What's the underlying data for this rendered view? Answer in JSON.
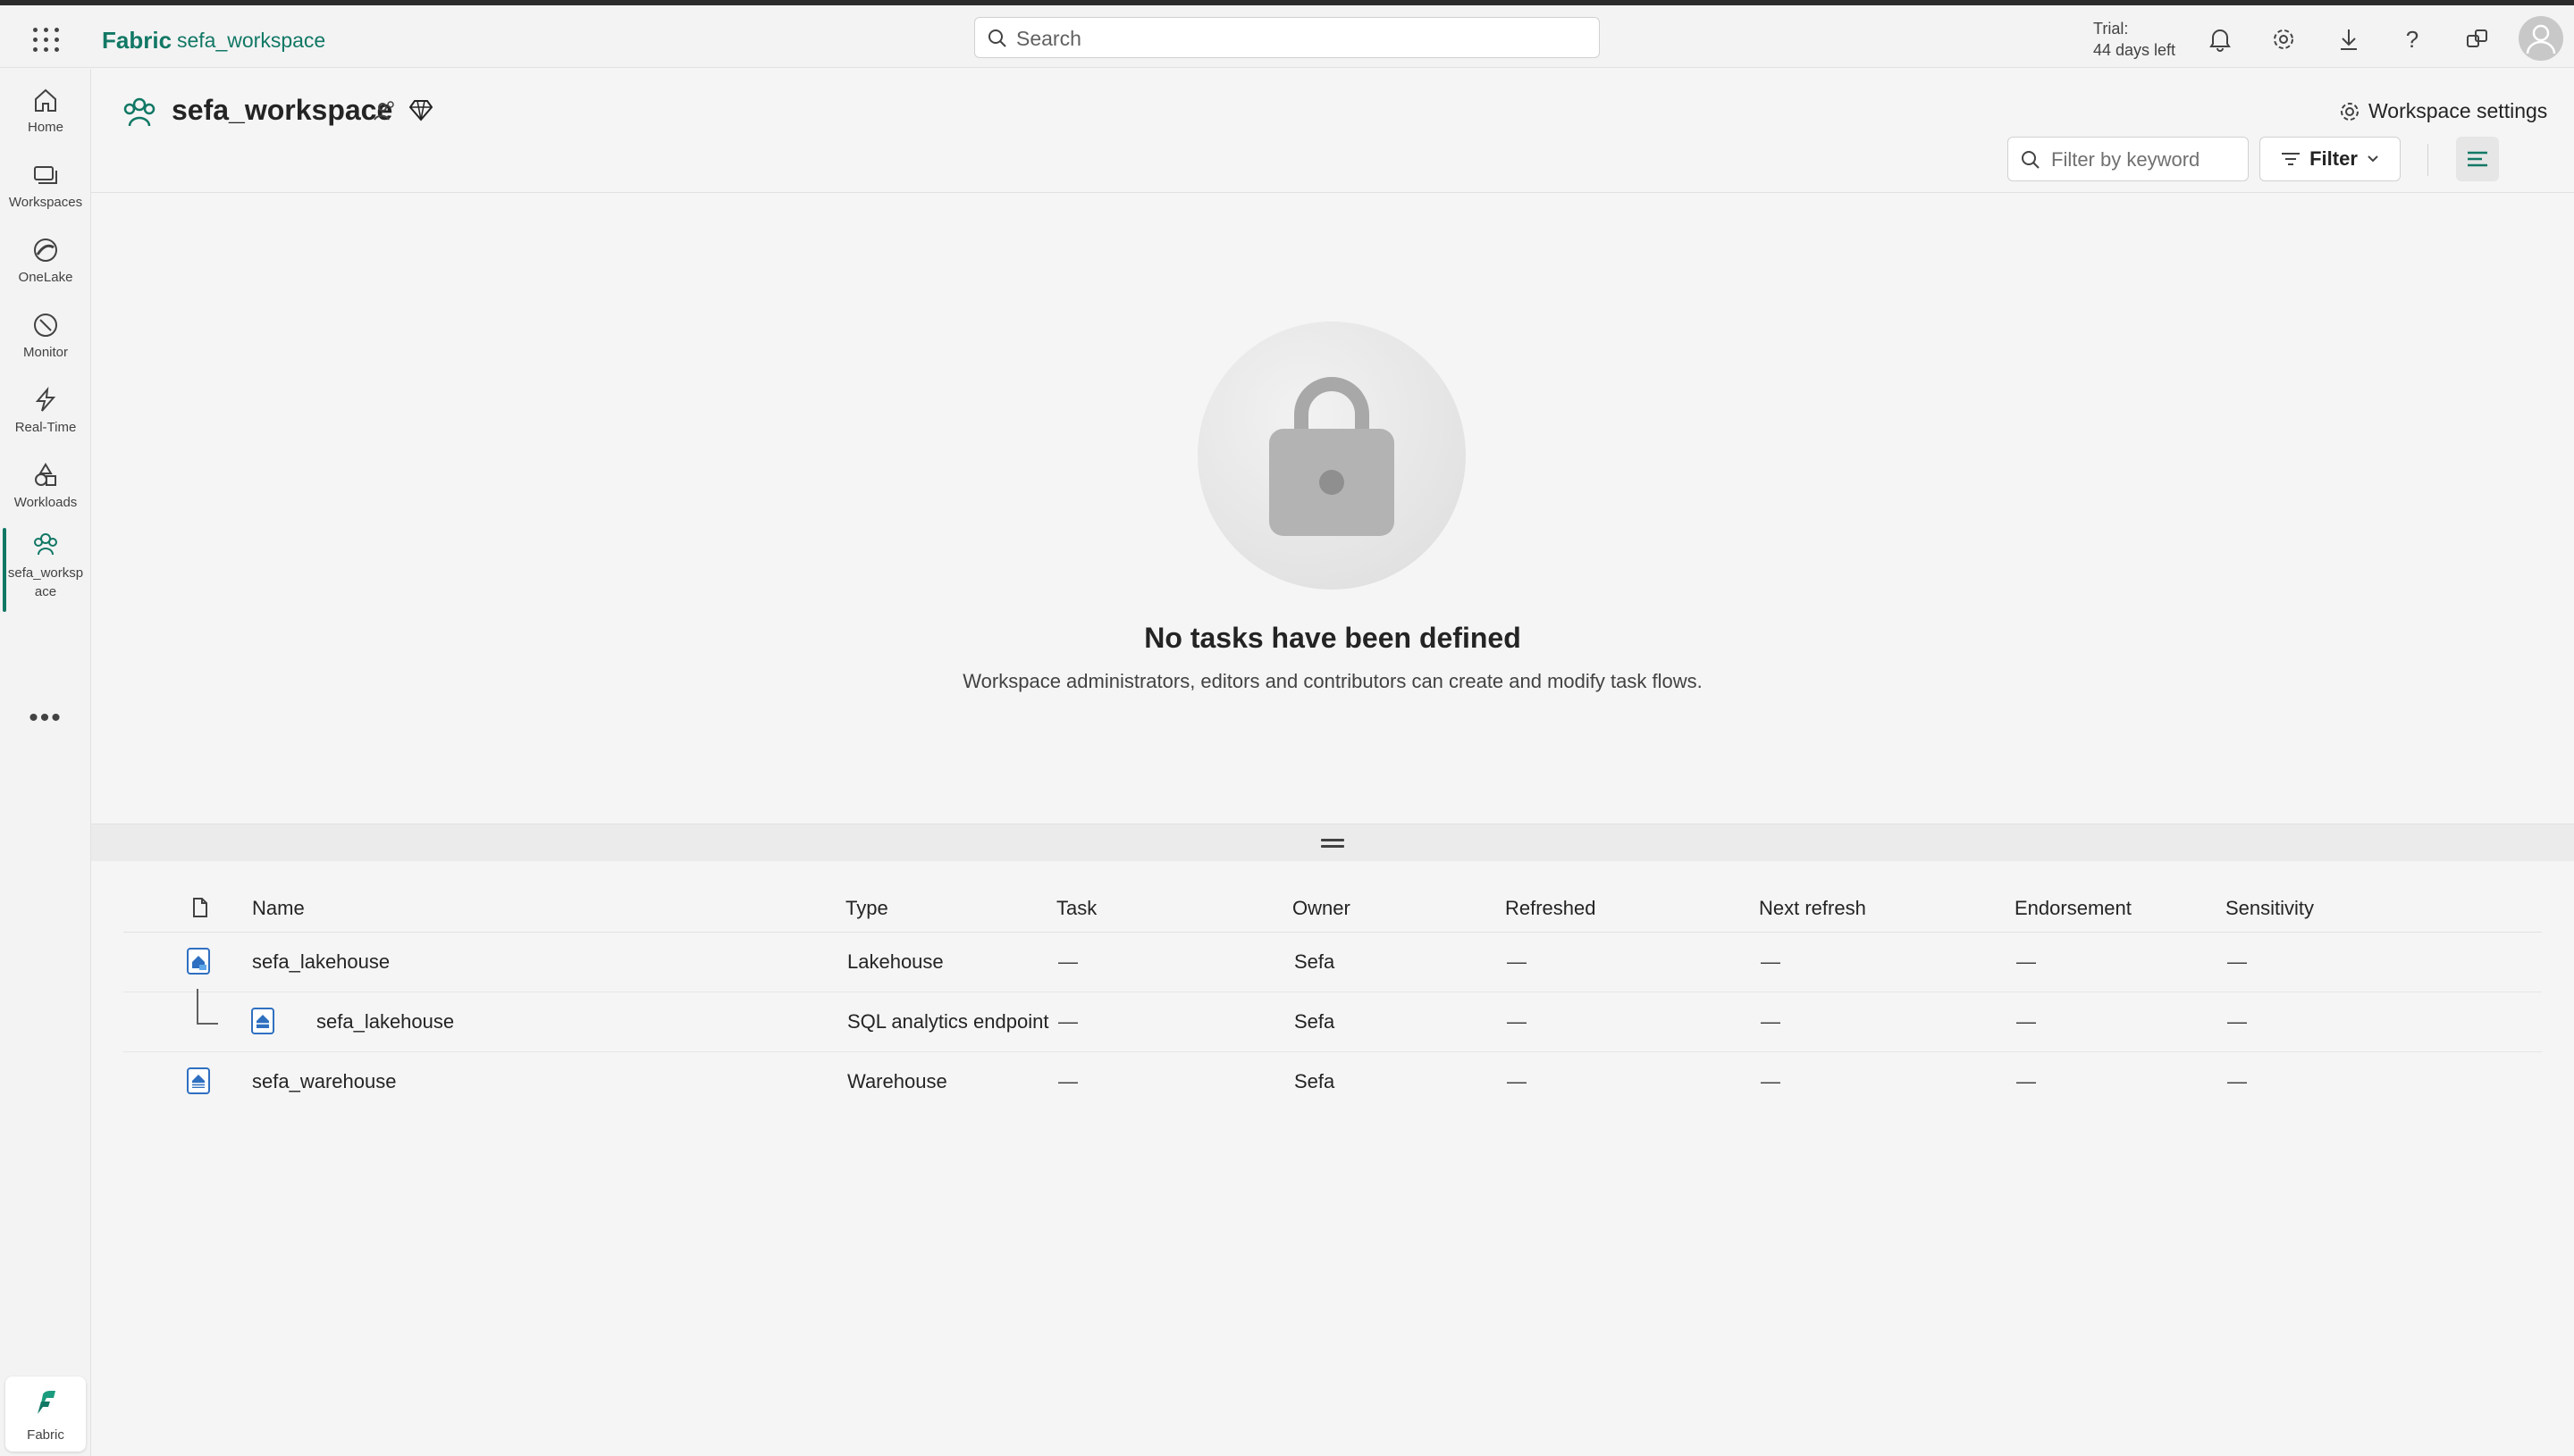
{
  "header": {
    "brand": "Fabric",
    "breadcrumb": "sefa_workspace",
    "search_placeholder": "Search",
    "trial_line1": "Trial:",
    "trial_line2": "44 days left",
    "icons": [
      "bell-icon",
      "gear-icon",
      "download-icon",
      "help-icon",
      "share-feedback-icon",
      "avatar-icon"
    ]
  },
  "rail": {
    "items": [
      {
        "label": "Home",
        "icon": "home-icon"
      },
      {
        "label": "Workspaces",
        "icon": "workspaces-icon"
      },
      {
        "label": "OneLake",
        "icon": "onelake-icon"
      },
      {
        "label": "Monitor",
        "icon": "monitor-icon"
      },
      {
        "label": "Real-Time",
        "icon": "realtime-icon"
      },
      {
        "label": "Workloads",
        "icon": "workloads-icon"
      },
      {
        "label_line1": "sefa_worksp",
        "label_line2": "ace",
        "icon": "workspace-group-icon"
      }
    ],
    "more": "•••",
    "footer_label": "Fabric"
  },
  "workspace": {
    "title": "sefa_workspace",
    "settings_label": "Workspace settings",
    "filter_placeholder": "Filter by keyword",
    "filter_label": "Filter"
  },
  "empty_state": {
    "title": "No tasks have been defined",
    "subtitle": "Workspace administrators, editors and contributors can create and modify task flows."
  },
  "table": {
    "columns": [
      "Name",
      "Type",
      "Task",
      "Owner",
      "Refreshed",
      "Next refresh",
      "Endorsement",
      "Sensitivity"
    ],
    "rows": [
      {
        "name": "sefa_lakehouse",
        "type": "Lakehouse",
        "task": "—",
        "owner": "Sefa",
        "refreshed": "—",
        "next_refresh": "—",
        "endorsement": "—",
        "sensitivity": "—"
      },
      {
        "name": "sefa_lakehouse",
        "type": "SQL analytics endpoint",
        "task": "—",
        "owner": "Sefa",
        "refreshed": "—",
        "next_refresh": "—",
        "endorsement": "—",
        "sensitivity": "—"
      },
      {
        "name": "sefa_warehouse",
        "type": "Warehouse",
        "task": "—",
        "owner": "Sefa",
        "refreshed": "—",
        "next_refresh": "—",
        "endorsement": "—",
        "sensitivity": "—"
      }
    ]
  },
  "colors": {
    "accent": "#117865",
    "item_icon_blue": "#2f6fc0"
  }
}
